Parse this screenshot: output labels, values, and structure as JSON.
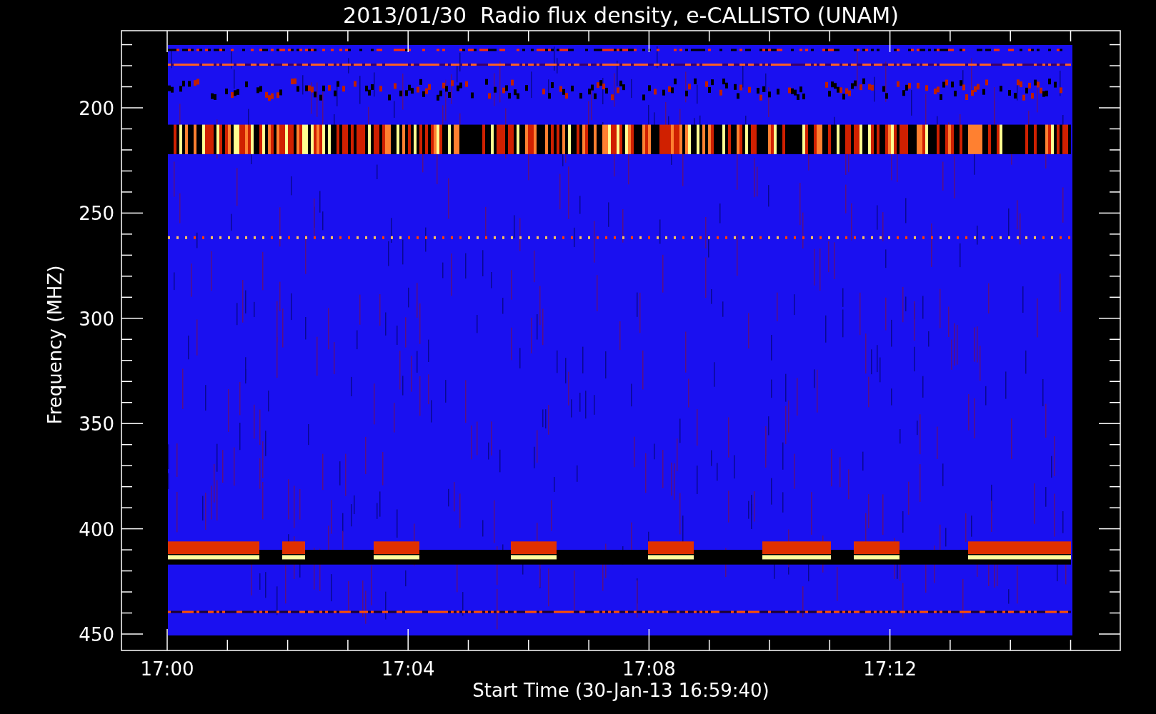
{
  "title": "2013/01/30  Radio flux density, e-CALLISTO (UNAM)",
  "y_axis": {
    "label": "Frequency (MHZ)",
    "ticks": [
      "200",
      "250",
      "300",
      "350",
      "400",
      "450"
    ]
  },
  "x_axis": {
    "label": "Start Time (30-Jan-13 16:59:40)",
    "ticks": [
      "17:00",
      "17:04",
      "17:08",
      "17:12"
    ]
  }
}
